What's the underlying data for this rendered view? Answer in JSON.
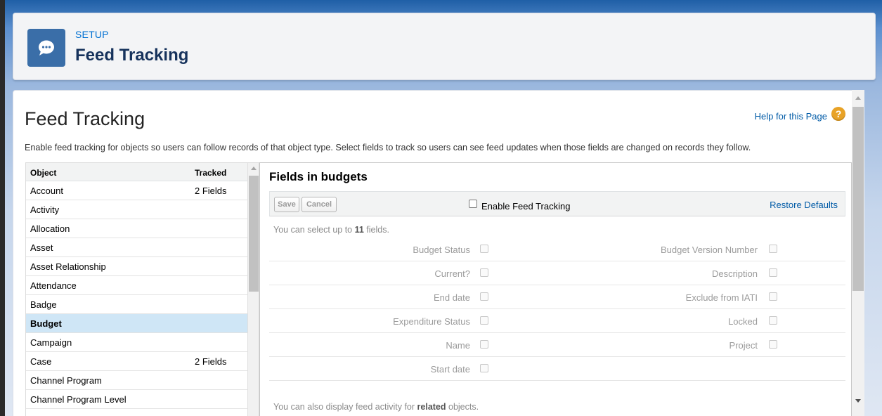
{
  "header": {
    "breadcrumb": "SETUP",
    "title": "Feed Tracking",
    "icon": "chat-bubble-icon"
  },
  "page": {
    "title": "Feed Tracking",
    "help_link": "Help for this Page",
    "help_icon": "?",
    "description": "Enable feed tracking for objects so users can follow records of that object type. Select fields to track so users can see feed updates when those fields are changed on records they follow."
  },
  "object_list": {
    "columns": [
      "Object",
      "Tracked"
    ],
    "rows": [
      {
        "name": "Account",
        "tracked": "2 Fields"
      },
      {
        "name": "Activity",
        "tracked": ""
      },
      {
        "name": "Allocation",
        "tracked": ""
      },
      {
        "name": "Asset",
        "tracked": ""
      },
      {
        "name": "Asset Relationship",
        "tracked": ""
      },
      {
        "name": "Attendance",
        "tracked": ""
      },
      {
        "name": "Badge",
        "tracked": ""
      },
      {
        "name": "Budget",
        "tracked": "",
        "selected": true
      },
      {
        "name": "Campaign",
        "tracked": ""
      },
      {
        "name": "Case",
        "tracked": "2 Fields"
      },
      {
        "name": "Channel Program",
        "tracked": ""
      },
      {
        "name": "Channel Program Level",
        "tracked": ""
      }
    ]
  },
  "fields_panel": {
    "title": "Fields in budgets",
    "save_label": "Save",
    "cancel_label": "Cancel",
    "enable_label": "Enable Feed Tracking",
    "restore_label": "Restore Defaults",
    "limit_prefix": "You can select up to ",
    "limit_count": "11",
    "limit_suffix": " fields.",
    "fields": [
      {
        "left": "Budget Status",
        "right": "Budget Version Number"
      },
      {
        "left": "Current?",
        "right": "Description"
      },
      {
        "left": "End date",
        "right": "Exclude from IATI"
      },
      {
        "left": "Expenditure Status",
        "right": "Locked"
      },
      {
        "left": "Name",
        "right": "Project"
      },
      {
        "left": "Start date",
        "right": ""
      }
    ],
    "related_prefix": "You can also display feed activity for ",
    "related_bold": "related",
    "related_suffix": " objects."
  },
  "colors": {
    "link": "#015ba7",
    "selected_row": "#cfe6f6",
    "header_icon_bg": "#3a6ea8",
    "help_icon": "#e8a226"
  }
}
